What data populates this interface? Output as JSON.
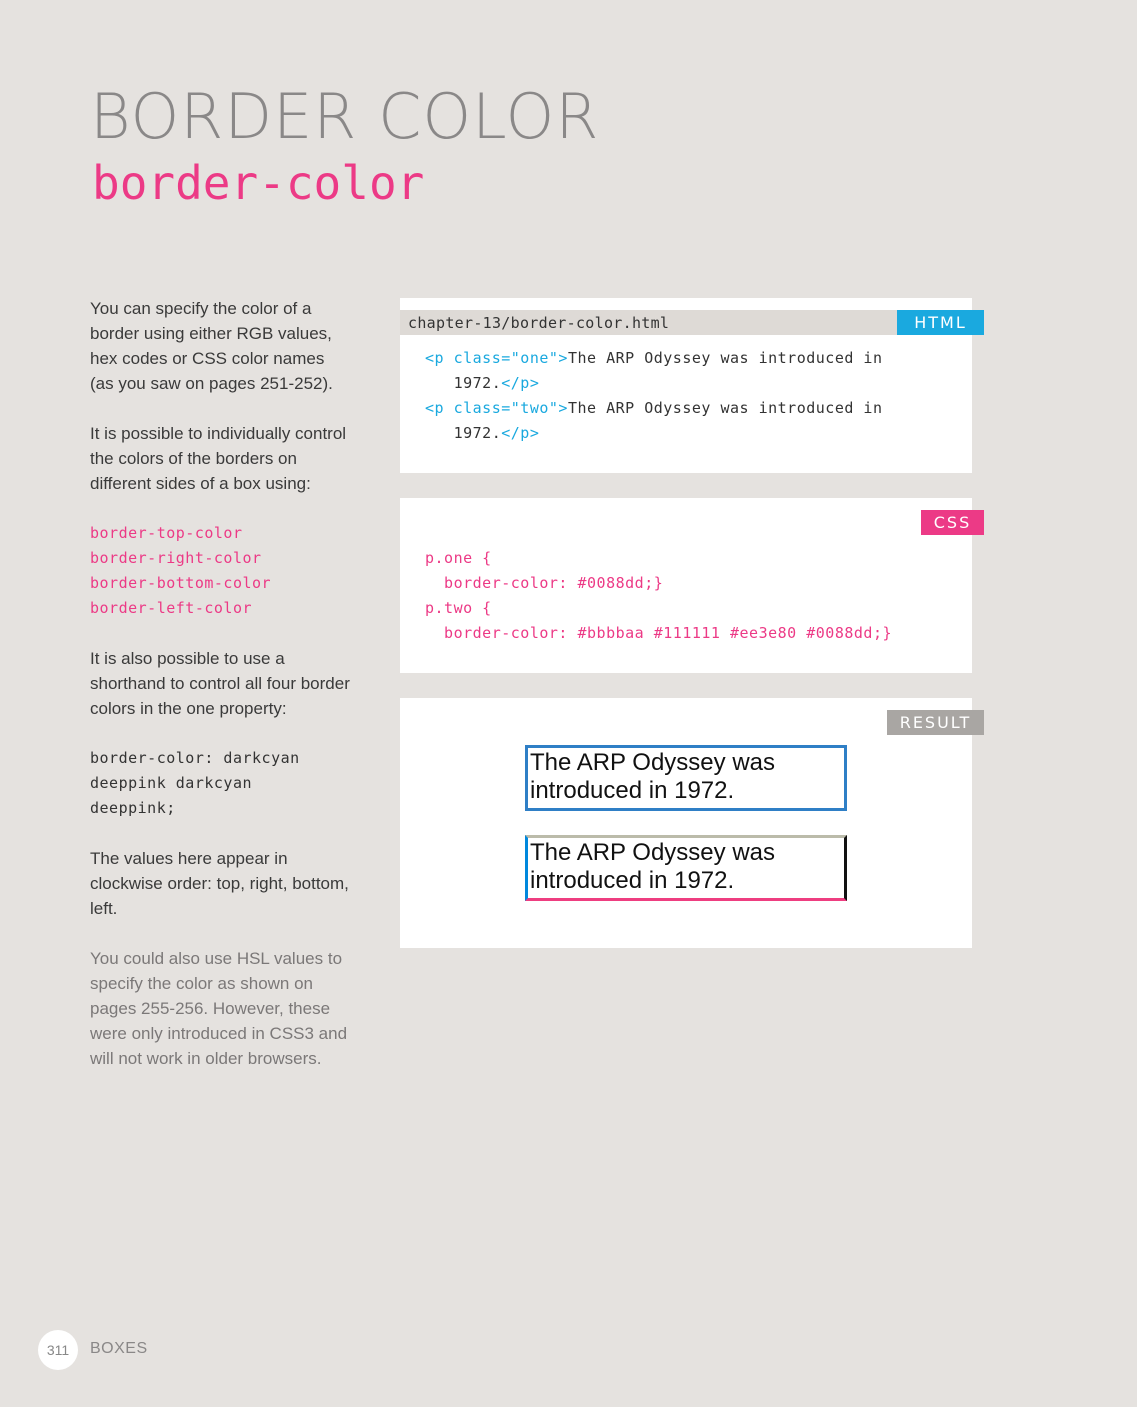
{
  "page": {
    "title": "BORDER COLOR",
    "subtitle": "border-color"
  },
  "sidebar": {
    "para1": "You can specify the color of a border using either RGB values, hex codes or CSS color names (as you saw on pages 251-252).",
    "para2": "It is possible to individually control the colors of the borders on different sides of a box using:",
    "props": [
      "border-top-color",
      "border-right-color",
      "border-bottom-color",
      "border-left-color"
    ],
    "para3": "It is also possible to use a shorthand to control all four border colors in the one property:",
    "shorthand_lines": [
      "border-color: darkcyan",
      "deeppink darkcyan",
      "deeppink;"
    ],
    "para4": "The values here appear in clockwise order: top, right, bottom, left.",
    "para5": "You could also use HSL values to specify the color as shown on pages 255-256. However, these were only introduced in CSS3 and will not work in older browsers."
  },
  "html_panel": {
    "filename": "chapter-13/border-color.html",
    "tag": "HTML",
    "lines": [
      {
        "open": "<p class=\"one\">",
        "text": "The ARP Odyssey was introduced in"
      },
      {
        "indent": "   ",
        "text": "1972.",
        "close": "</p>"
      },
      {
        "open": "<p class=\"two\">",
        "text": "The ARP Odyssey was introduced in"
      },
      {
        "indent": "   ",
        "text": "1972.",
        "close": "</p>"
      }
    ]
  },
  "css_panel": {
    "tag": "CSS",
    "lines": [
      "p.one {",
      "  border-color: #0088dd;}",
      "p.two {",
      "  border-color: #bbbbaa #111111 #ee3e80 #0088dd;}"
    ]
  },
  "result_panel": {
    "tag": "RESULT",
    "box_one_text": "The ARP Odyssey was introduced in 1972.",
    "box_two_text": "The ARP Odyssey was introduced in 1972."
  },
  "colors": {
    "html_tag": "#1aa9df",
    "css_tag": "#ec3a86",
    "result_tag": "#a9a6a3",
    "box_one_border": "#2f7fc6",
    "box_two_top": "#bbbbaa",
    "box_two_right": "#111111",
    "box_two_bottom": "#ee3e80",
    "box_two_left": "#0088dd"
  },
  "footer": {
    "page_number": "311",
    "section": "BOXES"
  }
}
